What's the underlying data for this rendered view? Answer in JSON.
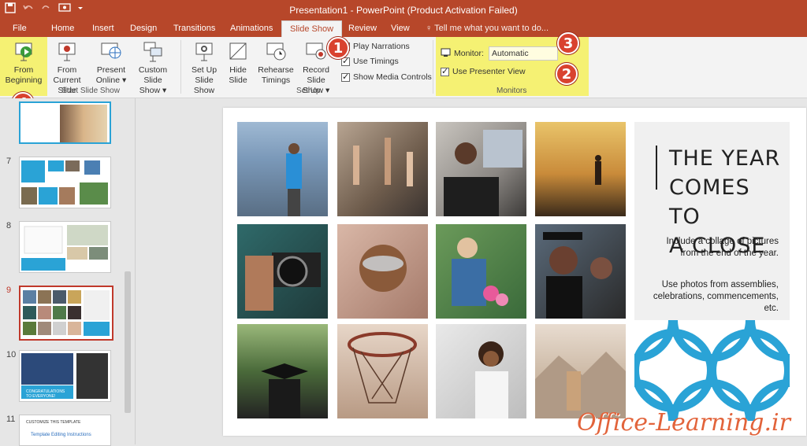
{
  "window": {
    "title": "Presentation1 - PowerPoint (Product Activation Failed)"
  },
  "tabs": [
    {
      "label": "File"
    },
    {
      "label": "Home"
    },
    {
      "label": "Insert"
    },
    {
      "label": "Design"
    },
    {
      "label": "Transitions"
    },
    {
      "label": "Animations"
    },
    {
      "label": "Slide Show"
    },
    {
      "label": "Review"
    },
    {
      "label": "View"
    }
  ],
  "active_tab": "Slide Show",
  "tell_me": "Tell me what you want to do...",
  "ribbon": {
    "start": {
      "from_beginning": "From\nBeginning",
      "from_current": "From\nCurrent Slide",
      "present_online": "Present\nOnline ▾",
      "custom_show": "Custom Slide\nShow ▾",
      "group_label": "Start Slide Show"
    },
    "setup": {
      "set_up": "Set Up\nSlide Show",
      "hide": "Hide\nSlide",
      "rehearse": "Rehearse\nTimings",
      "record": "Record Slide\nShow ▾",
      "play_narrations": "Play Narrations",
      "use_timings": "Use Timings",
      "show_media": "Show Media Controls",
      "group_label": "Set Up"
    },
    "monitors": {
      "monitor_label": "Monitor:",
      "monitor_value": "Automatic",
      "presenter_view": "Use Presenter View",
      "group_label": "Monitors"
    }
  },
  "callouts": [
    "1",
    "2",
    "3",
    "4"
  ],
  "slides": [
    {
      "number": "7"
    },
    {
      "number": "8"
    },
    {
      "number": "9"
    },
    {
      "number": "10"
    },
    {
      "number": "11"
    }
  ],
  "thumb_text": {
    "s11_title": "CUSTOMIZE THIS TEMPLATE",
    "s11_sub": "Template Editing Instructions",
    "s10_caption": "CONGRATULATIONS TO EVERYONE!"
  },
  "slide": {
    "title_lines": [
      "THE YEAR",
      "COMES TO",
      "A CLOSE"
    ],
    "desc1": "Include a collage of pictures from the end of the year.",
    "desc2": "Use photos from assemblies, celebrations, commencements, etc."
  },
  "watermark": "Office-Learning.ir",
  "colors": {
    "accent": "#b7472a",
    "highlight": "#f5f05c",
    "pattern": "#2aa3d6",
    "callout": "#d9422f"
  }
}
